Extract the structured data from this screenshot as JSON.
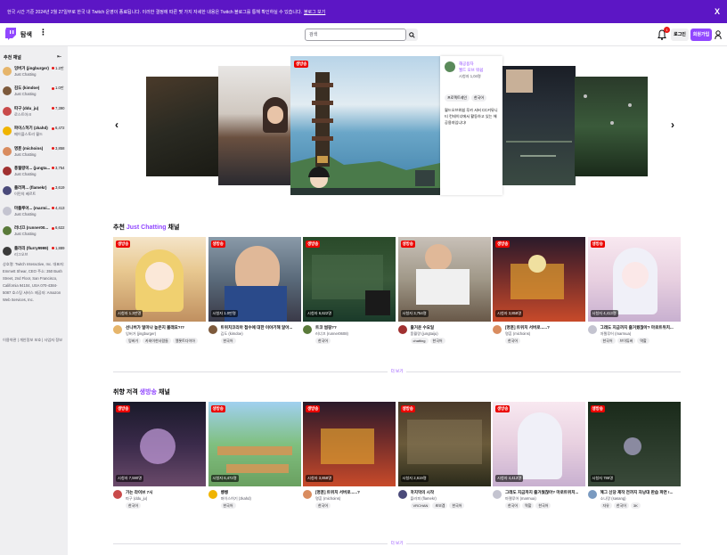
{
  "banner": {
    "message": "한국 시간 기준 2024년 2월 27일부로 한국 내 Twitch 운영이 종료됩니다. 이러한 결정에 따른 몇 가지 자세한 내용은 Twitch 블로그를 통해 확인하실 수 있습니다.",
    "link": "블로그 보기",
    "close": "X"
  },
  "topnav": {
    "browse": "탐색",
    "more": "⋮",
    "search_placeholder": "검색",
    "notif_count": "1",
    "login": "로그인",
    "signup": "회원가입"
  },
  "sidebar": {
    "title": "추천 채널",
    "collapse": "⇤",
    "items": [
      {
        "name": "잉버거 (jingburger)",
        "category": "Just Chatting",
        "viewers": "1.2만",
        "color": "#e6b56b"
      },
      {
        "name": "김도 (kimdoe)",
        "category": "Just Chatting",
        "viewers": "1.0만",
        "color": "#7d5a3c"
      },
      {
        "name": "따구 (ddu_ju)",
        "category": "로스트아크",
        "viewers": "7,390",
        "color": "#c94a4a"
      },
      {
        "name": "파이스허기 (zkahd)",
        "category": "메이플스토리 월드",
        "viewers": "6,472",
        "color": "#f0b400"
      },
      {
        "name": "명훈 (michoins)",
        "category": "Just Chatting",
        "viewers": "3,858",
        "color": "#d98c5f"
      },
      {
        "name": "풍월량이... (jungta...",
        "category": "Just Chatting",
        "viewers": "3,754",
        "color": "#a03030"
      },
      {
        "name": "플러퍼... (flamekr)",
        "category": "이민의 베르트",
        "viewers": "3,619",
        "color": "#4a4a7a"
      },
      {
        "name": "마플루어... (marmi...",
        "category": "Just Chatting",
        "viewers": "4,413",
        "color": "#c4c4d0"
      },
      {
        "name": "러너끄 (runner00...",
        "category": "Just Chatting",
        "viewers": "6,622",
        "color": "#5a7a3a"
      },
      {
        "name": "플러리 (flurry9999)",
        "category": "리그오브",
        "viewers": "1,889",
        "color": "#3a3a3a"
      }
    ],
    "footer": "상호명: Twitch Interactive, Inc. 대표자: Emmett Shear, CEO 주소: 350 Bush Street, 2nd Floor, San Francisco, California 94104, USA 070-4384-5087 호스팅 서비스 제공자: Amazon Web Services, Inc.",
    "links": "이용약관 | 개인정보 보호 | 사업자 정보"
  },
  "carousel": {
    "prev": "‹",
    "next": "›",
    "live": "생방송",
    "info": {
      "channel": "해공용자",
      "game": "월드 오브 워쉽",
      "viewers": "시청자 1,04명",
      "tags": [
        "프로젝트레인",
        "한국어"
      ],
      "description": "월드오브워쉽 루카 서버 CC커뮤니티 컨테이너에서 활동하고 있는 해공용자입니다!"
    }
  },
  "sections": [
    {
      "title_prefix": "추천",
      "title_accent": "Just Chatting",
      "title_suffix": "채널",
      "show_more": "더 보기",
      "cards": [
        {
          "viewers": "시청자 1.3만명",
          "title": "선니버가 얼마나 높은지 볼래요?!?",
          "name": "잉버거 (jingburger)",
          "tags": [
            "잉버거",
            "카와이한사람들",
            "엘롯트다이아"
          ],
          "avatar": "#e6b56b"
        },
        {
          "viewers": "시청자 1.0만명",
          "title": "트위치코리아 접수에 대한 이야기해 알아...",
          "name": "김도 (kimdoe)",
          "tags": [
            "한국어"
          ],
          "avatar": "#7d5a3c"
        },
        {
          "viewers": "시청자 6,622명",
          "title": "트코 썸핑??",
          "name": "러너끄 (runner0608)",
          "tags": [
            "한국어"
          ],
          "avatar": "#5a7a3a"
        },
        {
          "viewers": "시청자 3,754명",
          "title": "즐거운 수요일",
          "name": "풍월량 (jungtaiju)",
          "tags": [
            "chatting",
            "한국어"
          ],
          "avatar": "#a03030"
        },
        {
          "viewers": "시청자 3,858명",
          "title": "[명훈] 트위치 서버로......?",
          "name": "명훈 (michoins)",
          "tags": [
            "한국어"
          ],
          "avatar": "#d98c5f"
        },
        {
          "viewers": "시청자 4,413명",
          "title": "그래도 지금까지 즐거웠잖아? 마로트위치...",
          "name": "마젤루어 (marmua)",
          "tags": [
            "한국어",
            "브이튜버",
            "역할"
          ],
          "avatar": "#c4c4d0"
        }
      ]
    },
    {
      "title_prefix": "취향 저격",
      "title_accent": "생방송",
      "title_suffix": "채널",
      "show_more": "더 보기",
      "cards": [
        {
          "viewers": "시청자 7,590명",
          "title": "가는 라이브 7시",
          "name": "따구 (ddu_ju)",
          "tags": [
            "한국어"
          ],
          "avatar": "#c94a4a"
        },
        {
          "viewers": "시청자 6,472명",
          "title": "쌩쌩",
          "name": "파이스허기 (zkahd)",
          "tags": [
            "한국어"
          ],
          "avatar": "#f0b400"
        },
        {
          "viewers": "시청자 3,858명",
          "title": "[명훈] 트위치 서버로......?",
          "name": "명훈 (michoins)",
          "tags": [
            "한국어"
          ],
          "avatar": "#d98c5f",
          "category": "Just Chatting"
        },
        {
          "viewers": "시청자 2,619명",
          "title": "마지막의 시작",
          "name": "플러피 (flamekr)",
          "tags": [
            "VRCHAN",
            "초보겜",
            "한국어"
          ],
          "avatar": "#4a4a7a"
        },
        {
          "viewers": "시청자 4,413명",
          "title": "그래도 지금까지 즐거웠잖아? 마로트위치...",
          "name": "마젤루어 (marmua)",
          "tags": [
            "한국어",
            "역할",
            "한국어"
          ],
          "avatar": "#c4c4d0",
          "category": "Just Chatting"
        },
        {
          "viewers": "시청자 786명",
          "title": "혜그 신당 제작 전까지 자낭대 판습 파면 !...",
          "name": "소나랑 (sasang)",
          "tags": [
            "자유",
            "한국어",
            "3K"
          ],
          "avatar": "#7a9ac0"
        }
      ]
    }
  ]
}
